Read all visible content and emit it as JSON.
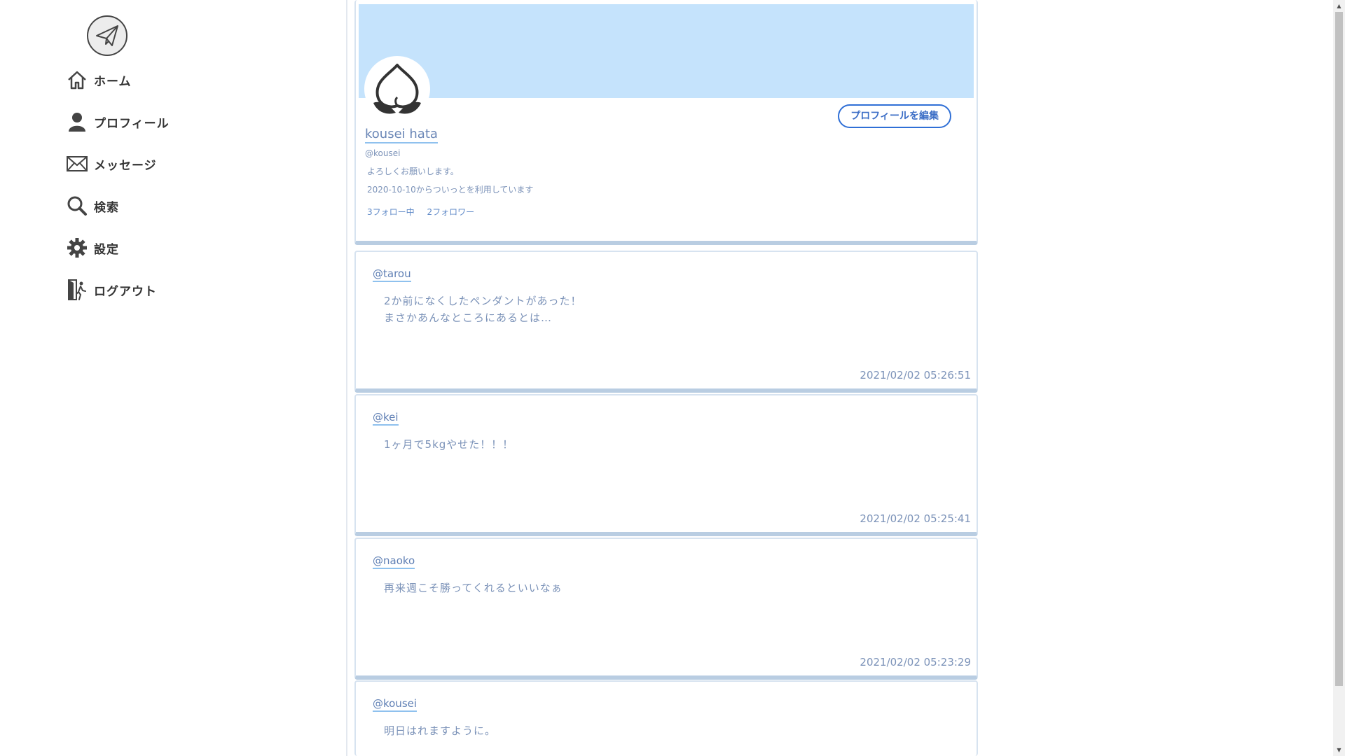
{
  "sidebar": {
    "items": [
      {
        "label": "ホーム",
        "icon": "home-icon"
      },
      {
        "label": "プロフィール",
        "icon": "user-icon"
      },
      {
        "label": "メッセージ",
        "icon": "mail-icon"
      },
      {
        "label": "検索",
        "icon": "search-icon"
      },
      {
        "label": "設定",
        "icon": "gear-icon"
      },
      {
        "label": "ログアウト",
        "icon": "logout-icon"
      }
    ]
  },
  "profile": {
    "display_name": "kousei hata",
    "handle": "@kousei",
    "bio": "よろしくお願いします。",
    "joined": "2020-10-10からついっとを利用しています",
    "following": "3フォロー中",
    "followers": "2フォロワー",
    "edit_label": "プロフィールを編集",
    "banner_color": "#c5e3fc"
  },
  "posts": [
    {
      "user": "@tarou",
      "body": "2か前になくしたペンダントがあった！\nまさかあんなところにあるとは…",
      "time": "2021/02/02 05:26:51"
    },
    {
      "user": "@kei",
      "body": "1ヶ月で5kgやせた！！！",
      "time": "2021/02/02 05:25:41"
    },
    {
      "user": "@naoko",
      "body": "再来週こそ勝ってくれるといいなぁ",
      "time": "2021/02/02 05:23:29"
    },
    {
      "user": "@kousei",
      "body": "明日はれますように。",
      "time": ""
    }
  ]
}
